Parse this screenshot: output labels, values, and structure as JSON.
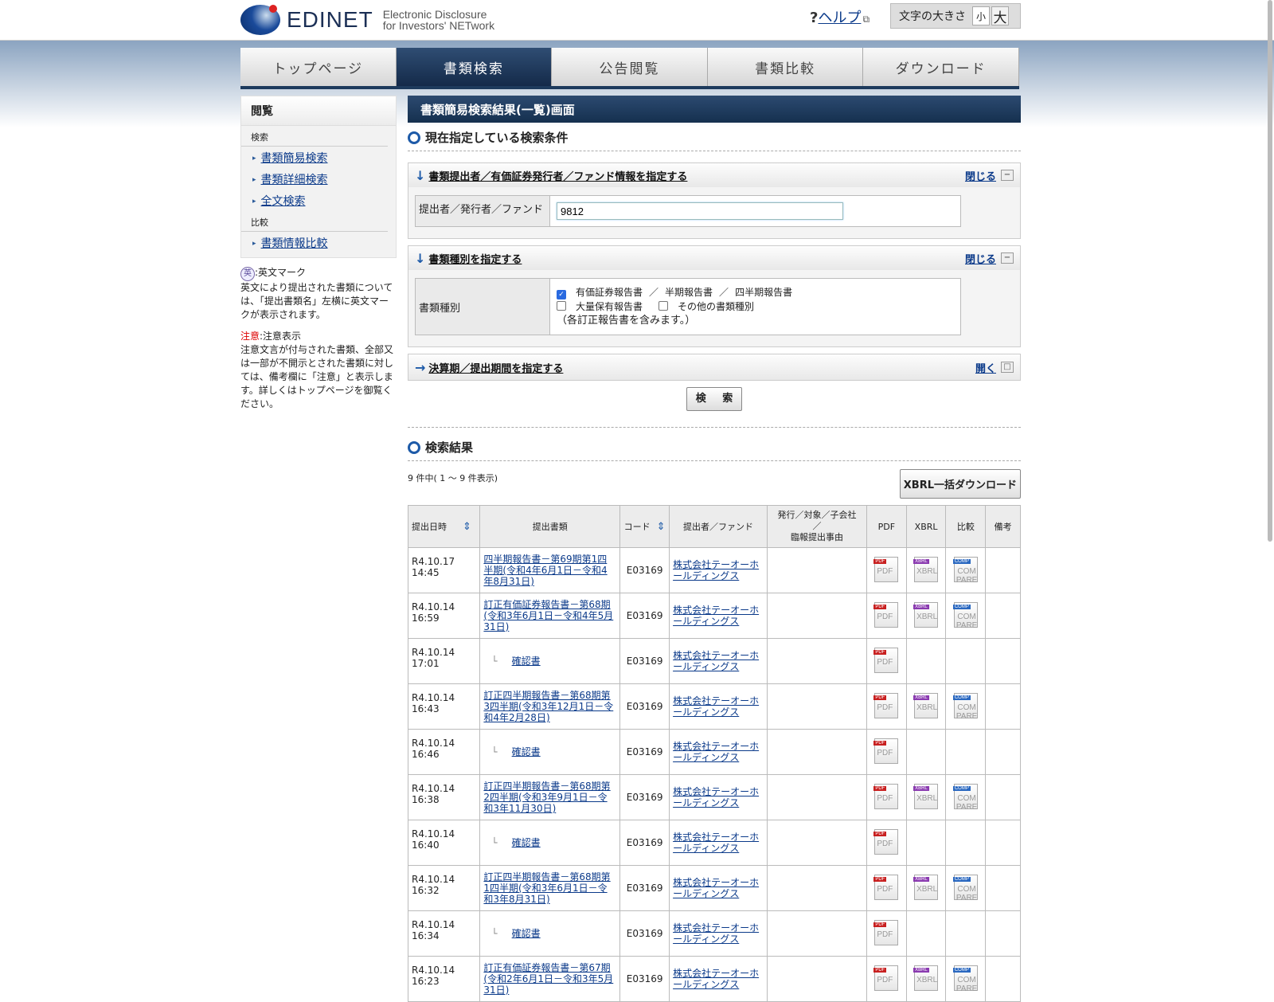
{
  "header": {
    "logo_text": "EDINET",
    "logo_sub1": "Electronic Disclosure",
    "logo_sub2": "for Investors' NETwork",
    "help_q": "?",
    "help_label": "ヘルプ",
    "font_size_label": "文字の大きさ",
    "font_small": "小",
    "font_large": "大"
  },
  "nav": {
    "tabs": [
      "トップページ",
      "書類検索",
      "公告閲覧",
      "書類比較",
      "ダウンロード"
    ]
  },
  "sidebar": {
    "title": "閲覧",
    "search_section": "検索",
    "search_items": [
      "書類簡易検索",
      "書類詳細検索",
      "全文検索"
    ],
    "compare_section": "比較",
    "compare_items": [
      "書類情報比較"
    ],
    "en_mark_glyph": "英",
    "en_mark_label": ":英文マーク",
    "en_mark_desc": "英文により提出された書類については、「提出書類名」左横に英文マークが表示されます。",
    "caution_label": "注意",
    "caution_suffix": ":注意表示",
    "caution_desc": "注意文言が付与された書類、全部又は一部が不開示とされた書類に対しては、備考欄に「注意」と表示します。詳しくはトップページを御覧ください。"
  },
  "main": {
    "page_title": "書類簡易検索結果(一覧)画面",
    "conditions_heading": "現在指定している検索条件",
    "panel_filer": {
      "title": "書類提出者／有価証券発行者／ファンド情報を指定する",
      "toggle": "閉じる",
      "label": "提出者／発行者／ファンド",
      "value": "9812"
    },
    "panel_doctype": {
      "title": "書類種別を指定する",
      "toggle": "閉じる",
      "label": "書類種別",
      "opt1": "有価証券報告書",
      "opt1b": "半期報告書",
      "opt1c": "四半期報告書",
      "slash": "／",
      "opt2": "大量保有報告書",
      "opt3": "その他の書類種別",
      "note": "（各訂正報告書を含みます。）"
    },
    "panel_period": {
      "title": "決算期／提出期間を指定する",
      "toggle": "開く"
    },
    "search_button": "検 索",
    "results_heading": "検索結果",
    "count_text": "9 件中( 1 ～ 9 件表示)",
    "xbrl_bulk": "XBRL一括ダウンロード",
    "columns": {
      "date": "提出日時",
      "doc": "提出書類",
      "code": "コード",
      "filer": "提出者／ファンド",
      "reason1": "発行／対象／子会社",
      "reason2": "／",
      "reason3": "臨報提出事由",
      "pdf": "PDF",
      "xbrl": "XBRL",
      "compare": "比較",
      "note": "備考"
    },
    "icon_labels": {
      "pdf_tag": "PDF",
      "pdf_big": "PDF",
      "xbrl_tag": "XBRL",
      "xbrl_big": "XBRL",
      "comp_tag": "COMP",
      "comp_big": "COM PARE",
      "tree": "└"
    },
    "rows": [
      {
        "date": "R4.10.17 14:45",
        "doc": "四半期報告書－第69期第1四半期(令和4年6月1日－令和4年8月31日)",
        "child": false,
        "code": "E03169",
        "filer": "株式会社テーオーホールディングス",
        "xbrl": true
      },
      {
        "date": "R4.10.14 16:59",
        "doc": "訂正有価証券報告書－第68期(令和3年6月1日－令和4年5月31日)",
        "child": false,
        "code": "E03169",
        "filer": "株式会社テーオーホールディングス",
        "xbrl": true
      },
      {
        "date": "R4.10.14 17:01",
        "doc": "確認書",
        "child": true,
        "code": "E03169",
        "filer": "株式会社テーオーホールディングス",
        "xbrl": false
      },
      {
        "date": "R4.10.14 16:43",
        "doc": "訂正四半期報告書－第68期第3四半期(令和3年12月1日－令和4年2月28日)",
        "child": false,
        "code": "E03169",
        "filer": "株式会社テーオーホールディングス",
        "xbrl": true
      },
      {
        "date": "R4.10.14 16:46",
        "doc": "確認書",
        "child": true,
        "code": "E03169",
        "filer": "株式会社テーオーホールディングス",
        "xbrl": false
      },
      {
        "date": "R4.10.14 16:38",
        "doc": "訂正四半期報告書－第68期第2四半期(令和3年9月1日－令和3年11月30日)",
        "child": false,
        "code": "E03169",
        "filer": "株式会社テーオーホールディングス",
        "xbrl": true
      },
      {
        "date": "R4.10.14 16:40",
        "doc": "確認書",
        "child": true,
        "code": "E03169",
        "filer": "株式会社テーオーホールディングス",
        "xbrl": false
      },
      {
        "date": "R4.10.14 16:32",
        "doc": "訂正四半期報告書－第68期第1四半期(令和3年6月1日－令和3年8月31日)",
        "child": false,
        "code": "E03169",
        "filer": "株式会社テーオーホールディングス",
        "xbrl": true
      },
      {
        "date": "R4.10.14 16:34",
        "doc": "確認書",
        "child": true,
        "code": "E03169",
        "filer": "株式会社テーオーホールディングス",
        "xbrl": false
      },
      {
        "date": "R4.10.14 16:23",
        "doc": "訂正有価証券報告書－第67期(令和2年6月1日－令和3年5月31日)",
        "child": false,
        "code": "E03169",
        "filer": "株式会社テーオーホールディングス",
        "xbrl": true
      }
    ]
  }
}
